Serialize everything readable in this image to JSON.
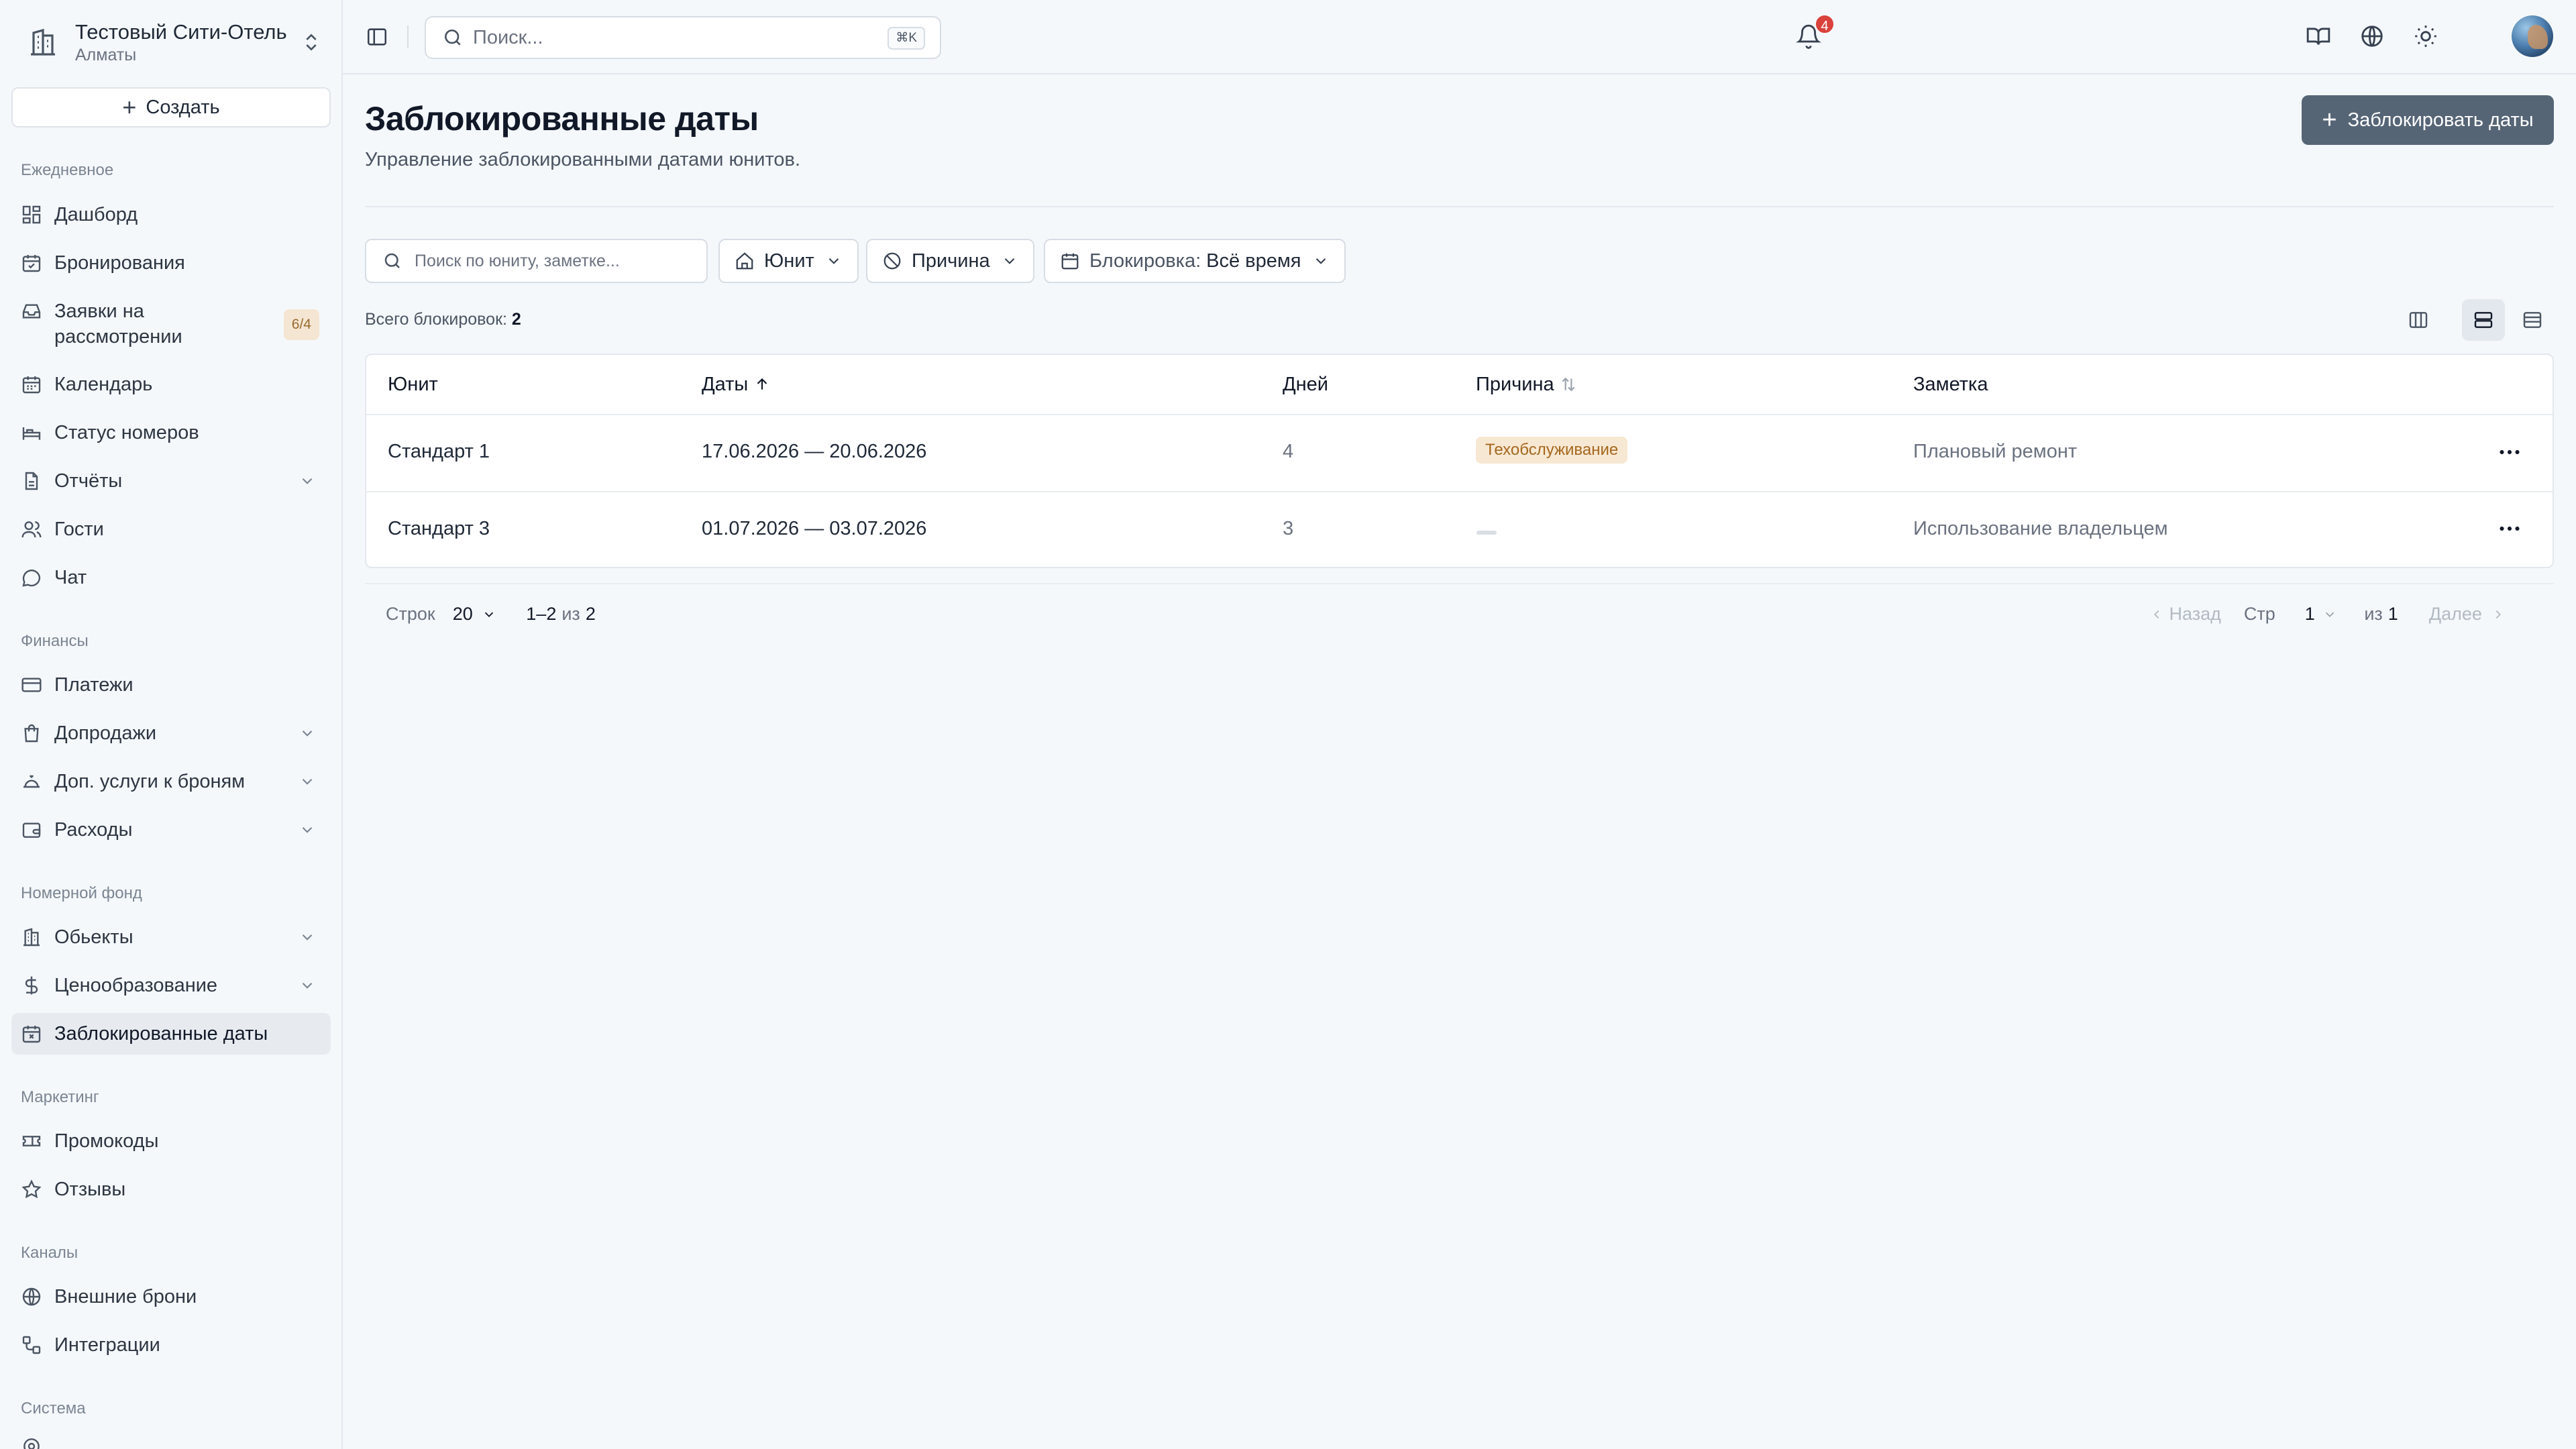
{
  "hotel": {
    "name": "Тестовый Сити-Отель",
    "city": "Алматы"
  },
  "create_label": "Создать",
  "sidebar": {
    "sections": [
      {
        "title": "Ежедневное"
      },
      {
        "title": "Финансы"
      },
      {
        "title": "Номерной фонд"
      },
      {
        "title": "Маркетинг"
      },
      {
        "title": "Каналы"
      },
      {
        "title": "Система"
      }
    ],
    "items": [
      {
        "label": "Дашборд",
        "icon": "dashboard-icon"
      },
      {
        "label": "Бронирования",
        "icon": "calendar-check-icon"
      },
      {
        "label": "Заявки на рассмотрении",
        "icon": "inbox-icon",
        "badge": "6/4"
      },
      {
        "label": "Календарь",
        "icon": "calendar-icon"
      },
      {
        "label": "Статус номеров",
        "icon": "bed-icon"
      },
      {
        "label": "Отчёты",
        "icon": "file-icon"
      },
      {
        "label": "Гости",
        "icon": "users-icon"
      },
      {
        "label": "Чат",
        "icon": "chat-icon"
      },
      {
        "label": "Платежи",
        "icon": "credit-card-icon"
      },
      {
        "label": "Допродажи",
        "icon": "shopping-bag-icon"
      },
      {
        "label": "Доп. услуги к броням",
        "icon": "service-bell-icon"
      },
      {
        "label": "Расходы",
        "icon": "wallet-icon"
      },
      {
        "label": "Обьекты",
        "icon": "building-icon"
      },
      {
        "label": "Ценообразование",
        "icon": "dollar-icon"
      },
      {
        "label": "Заблокированные даты",
        "icon": "calendar-x-icon"
      },
      {
        "label": "Промокоды",
        "icon": "ticket-icon"
      },
      {
        "label": "Отзывы",
        "icon": "star-icon"
      },
      {
        "label": "Внешние брони",
        "icon": "globe-icon"
      },
      {
        "label": "Интеграции",
        "icon": "workflow-icon"
      }
    ]
  },
  "topbar": {
    "search_placeholder": "Поиск...",
    "shortcut": "⌘K",
    "notifications": "4"
  },
  "page": {
    "title": "Заблокированные даты",
    "subtitle": "Управление заблокированными датами юнитов.",
    "primary_action": "Заблокировать даты"
  },
  "filters": {
    "search_placeholder": "Поиск по юниту, заметке...",
    "unit": "Юнит",
    "reason": "Причина",
    "block_label": "Блокировка:",
    "block_value": "Всё время"
  },
  "total": {
    "label": "Всего блокировок:",
    "value": "2"
  },
  "table": {
    "columns": [
      "Юнит",
      "Даты",
      "Дней",
      "Причина",
      "Заметка"
    ],
    "rows": [
      {
        "unit": "Стандарт 1",
        "dates": "17.06.2026 — 20.06.2026",
        "days": "4",
        "reason": "Техобслуживание",
        "note": "Плановый ремонт"
      },
      {
        "unit": "Стандарт 3",
        "dates": "01.07.2026 — 03.07.2026",
        "days": "3",
        "reason": "",
        "note": "Использование владельцем"
      }
    ]
  },
  "pagination": {
    "rows_label": "Строк",
    "rows_value": "20",
    "range": "1–2",
    "of": "из",
    "total": "2",
    "prev": "Назад",
    "page_label": "Стр",
    "page_value": "1",
    "of_pages_label": "из",
    "pages": "1",
    "next": "Далее"
  },
  "colors": {
    "accent": "#566576",
    "tag_bg": "#f7e8d3",
    "tag_text": "#a6671e",
    "badge": "#d9413a"
  }
}
